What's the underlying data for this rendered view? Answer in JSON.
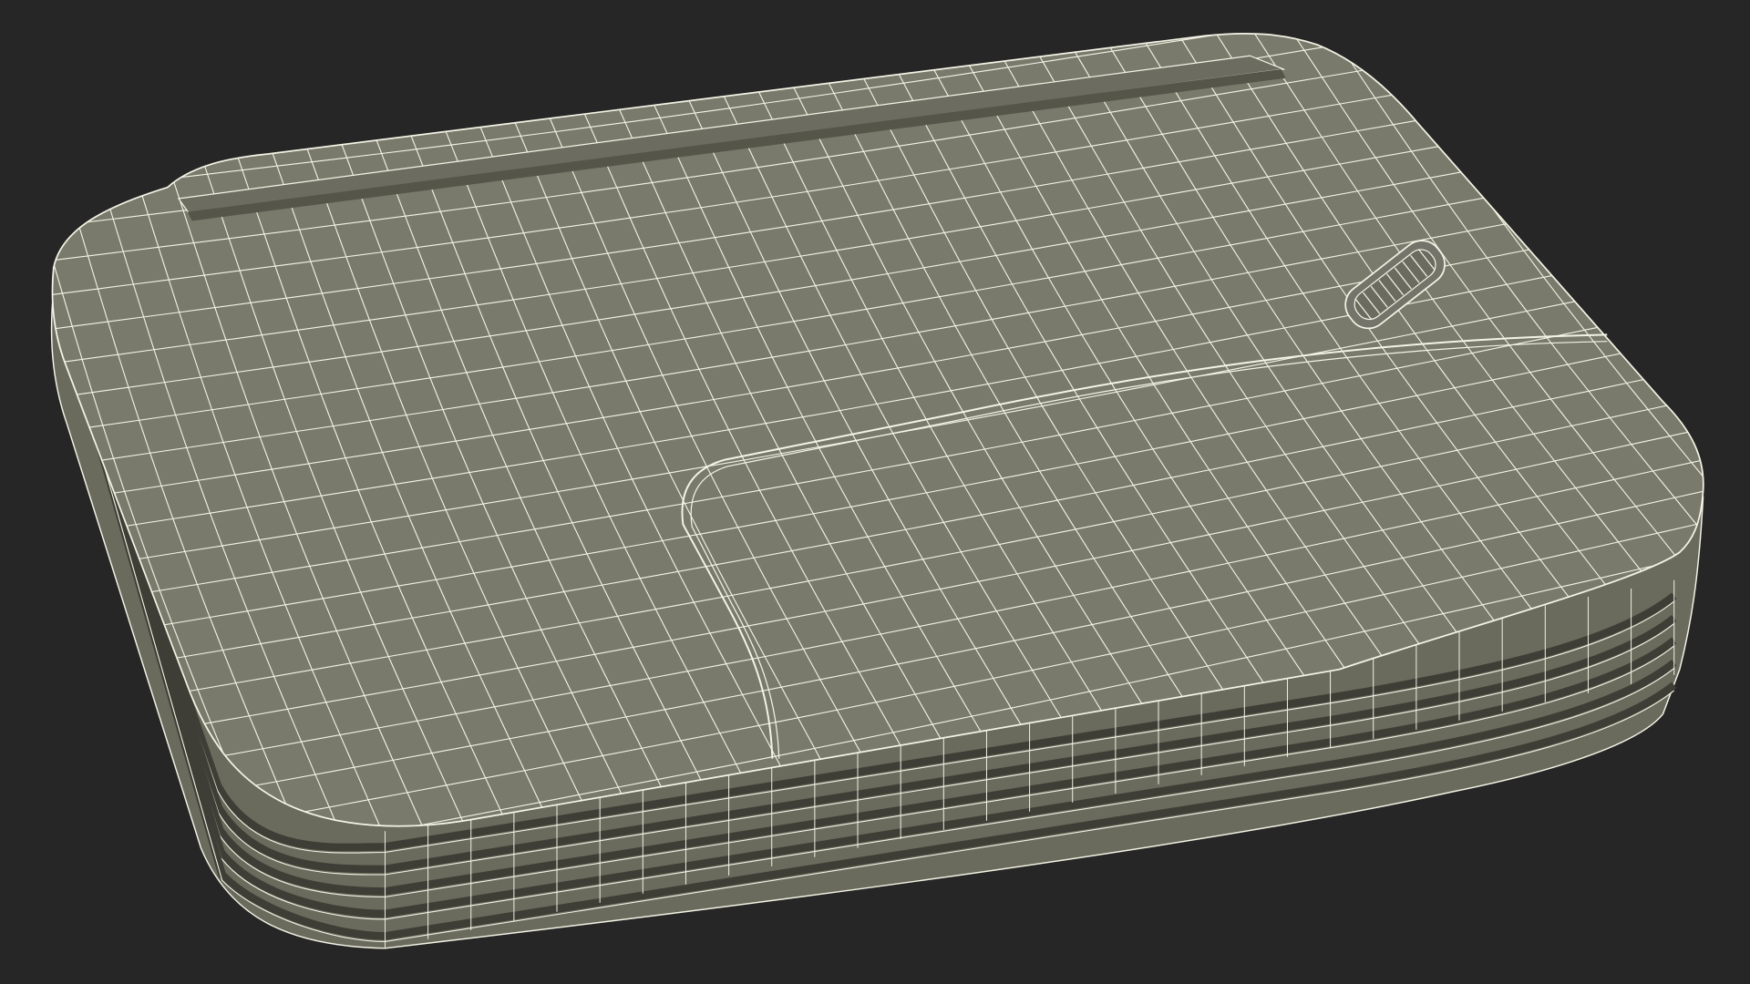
{
  "scene": {
    "subject": "router-wireframe-render",
    "background_color": "#262626",
    "body_color": "#7a7a6c",
    "body_shadow_color": "#5e5e52",
    "groove_color": "#3e3e36",
    "wire_color": "#f4f4e6",
    "vent_icon": "vent-grille-icon"
  }
}
